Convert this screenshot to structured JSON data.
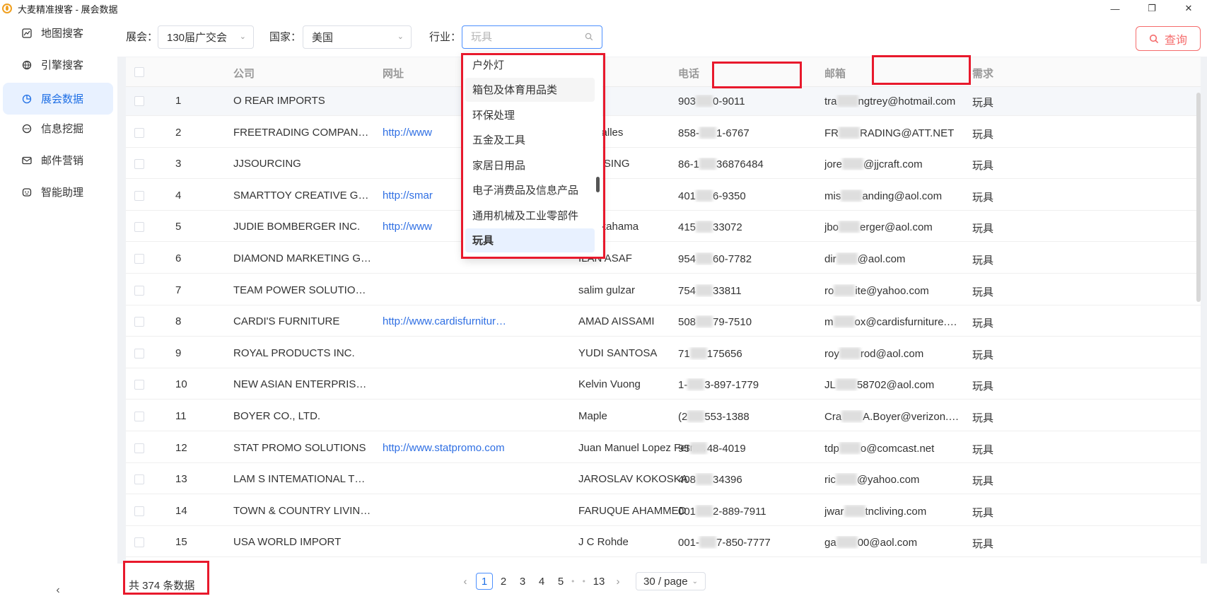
{
  "window": {
    "title": "大麦精准搜客 - 展会数据",
    "minimize": "—",
    "restore": "❐",
    "close": "✕"
  },
  "sidebar": {
    "items": [
      {
        "label": "地图搜客",
        "icon": "map-icon"
      },
      {
        "label": "引擎搜客",
        "icon": "globe-icon"
      },
      {
        "label": "展会数据",
        "icon": "pie-chart-icon",
        "active": true
      },
      {
        "label": "信息挖掘",
        "icon": "dots-chat-icon"
      },
      {
        "label": "邮件营销",
        "icon": "mail-icon"
      },
      {
        "label": "智能助理",
        "icon": "robot-icon"
      }
    ],
    "collapse": "‹"
  },
  "filters": {
    "exhibition_label": "展会：",
    "exhibition_value": "130届广交会",
    "country_label": "国家：",
    "country_value": "美国",
    "industry_label": "行业：",
    "industry_placeholder": "玩具",
    "query_button": "查询"
  },
  "industry_dropdown": {
    "options": [
      "户外灯",
      "箱包及体育用品类",
      "环保处理",
      "五金及工具",
      "家居日用品",
      "电子消费品及信息产品",
      "通用机械及工业零部件",
      "玩具"
    ],
    "hovered": "箱包及体育用品类",
    "selected": "玩具"
  },
  "table": {
    "columns": {
      "company": "公司",
      "website": "网址",
      "phone": "电话",
      "email": "邮箱",
      "demand": "需求"
    },
    "rows": [
      {
        "no": "1",
        "company": "O REAR IMPORTS",
        "website": "",
        "contact_tail": "n",
        "phone_a": "903",
        "phone_b": "0-9011",
        "email_a": "tra",
        "email_b": "ngtrey@hotmail.com",
        "demand": "玩具"
      },
      {
        "no": "2",
        "company": "FREETRADING COMPAN…",
        "website_tail": "http://www",
        "contact_tail": "do Galles",
        "phone_a": "858-",
        "phone_b": "1-6767",
        "email_a": "FR",
        "email_b": "RADING@ATT.NET",
        "demand": "玩具"
      },
      {
        "no": "3",
        "company": "JJSOURCING",
        "website_tail": "",
        "contact_tail": "KOK SING",
        "phone_a": "86-1",
        "phone_b": "36876484",
        "email_a": "jore",
        "email_b": "@jjcraft.com",
        "demand": "玩具"
      },
      {
        "no": "4",
        "company": "SMARTTOY CREATIVE GI…",
        "website_tail": "http://smar",
        "contact_tail": "u",
        "phone_a": "401",
        "phone_b": "6-9350",
        "email_a": "mis",
        "email_b": "anding@aol.com",
        "demand": "玩具"
      },
      {
        "no": "5",
        "company": "JUDIE BOMBERGER INC.",
        "website_tail": "http://www",
        "contact_tail": "o Nakahama",
        "phone_a": "415",
        "phone_b": "33072",
        "email_a": "jbo",
        "email_b": "erger@aol.com",
        "demand": "玩具"
      },
      {
        "no": "6",
        "company": "DIAMOND MARKETING G…",
        "website_tail": "",
        "contact_tail": "ILAN ASAF",
        "phone_a": "954",
        "phone_b": "60-7782",
        "email_a": "dir",
        "email_b": "@aol.com",
        "demand": "玩具"
      },
      {
        "no": "7",
        "company": "TEAM POWER SOLUTION…",
        "website_tail": "",
        "contact_tail": "salim gulzar",
        "phone_a": "754",
        "phone_b": "33811",
        "email_a": "ro",
        "email_b": "ite@yahoo.com",
        "demand": "玩具"
      },
      {
        "no": "8",
        "company": "CARDI'S FURNITURE",
        "website_tail": "http://www.cardisfurnitur…",
        "contact_tail": "AMAD AISSAMI",
        "phone_a": "508",
        "phone_b": "79-7510",
        "email_a": "m",
        "email_b": "ox@cardisfurniture.…",
        "demand": "玩具"
      },
      {
        "no": "9",
        "company": "ROYAL PRODUCTS INC.",
        "website_tail": "",
        "contact_tail": "YUDI SANTOSA",
        "phone_a": "71",
        "phone_b": "175656",
        "email_a": "roy",
        "email_b": "rod@aol.com",
        "demand": "玩具"
      },
      {
        "no": "10",
        "company": "NEW ASIAN ENTERPRISE…",
        "website_tail": "",
        "contact_tail": "Kelvin Vuong",
        "phone_a": "1-",
        "phone_b": "3-897-1779",
        "email_a": "JL",
        "email_b": "58702@aol.com",
        "demand": "玩具"
      },
      {
        "no": "11",
        "company": "BOYER CO., LTD.",
        "website_tail": "",
        "contact_tail": "Maple",
        "phone_a": "(2",
        "phone_b": "553-1388",
        "email_a": "Cra",
        "email_b": "A.Boyer@verizon.net",
        "demand": "玩具"
      },
      {
        "no": "12",
        "company": "STAT PROMO SOLUTIONS",
        "website_tail": "http://www.statpromo.com",
        "contact_tail": "Juan Manuel Lopez Fern…",
        "phone_a": "95",
        "phone_b": "48-4019",
        "email_a": "tdp",
        "email_b": "o@comcast.net",
        "demand": "玩具"
      },
      {
        "no": "13",
        "company": "LAM S INTEMATIONAL T…",
        "website_tail": "",
        "contact_tail": "JAROSLAV KOKOSKA",
        "phone_a": "408",
        "phone_b": "34396",
        "email_a": "ric",
        "email_b": "@yahoo.com",
        "demand": "玩具"
      },
      {
        "no": "14",
        "company": "TOWN & COUNTRY LIVIN…",
        "website_tail": "",
        "contact_tail": "FARUQUE AHAMMED",
        "phone_a": "001",
        "phone_b": "2-889-7911",
        "email_a": "jwar",
        "email_b": "tncliving.com",
        "demand": "玩具"
      },
      {
        "no": "15",
        "company": "USA WORLD IMPORT",
        "website_tail": "",
        "contact_tail": "J C Rohde",
        "phone_a": "001-",
        "phone_b": "7-850-7777",
        "email_a": "ga",
        "email_b": "00@aol.com",
        "demand": "玩具"
      }
    ]
  },
  "footer": {
    "total": "共 374 条数据",
    "prev": "‹",
    "pages": [
      "1",
      "2",
      "3",
      "4",
      "5"
    ],
    "ellipsis": "• •",
    "last_page": "13",
    "next": "›",
    "page_size": "30 / page",
    "current_page": "1"
  },
  "colors": {
    "accent": "#1f6fe5",
    "link": "#2f6fe3",
    "danger": "#f56c6c",
    "highlight_box": "#e8192c"
  }
}
